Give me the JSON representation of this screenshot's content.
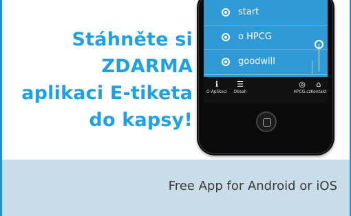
{
  "headline": {
    "line1": "Stáhněte si",
    "line2": "ZDARMA",
    "line3": "aplikaci E-tiketa",
    "line4": "do kapsy!"
  },
  "phone": {
    "menu_items": [
      {
        "label": "start"
      },
      {
        "label": "o HPCG"
      },
      {
        "label": "goodwill"
      }
    ],
    "tabs": [
      {
        "icon": "info-icon",
        "label": "O Aplikaci"
      },
      {
        "icon": "list-icon",
        "label": "Obsah"
      },
      {
        "icon": "globe-icon",
        "label": "HPCG.cz"
      },
      {
        "icon": "home-icon",
        "label": "Kontakt"
      }
    ]
  },
  "footer": {
    "text": "Free App for Android or iOS"
  },
  "colors": {
    "accent": "#1ea1e3",
    "screen": "#2f9ad6",
    "footer_bg": "#c9dde8",
    "footer_text": "#3a3a3a"
  }
}
